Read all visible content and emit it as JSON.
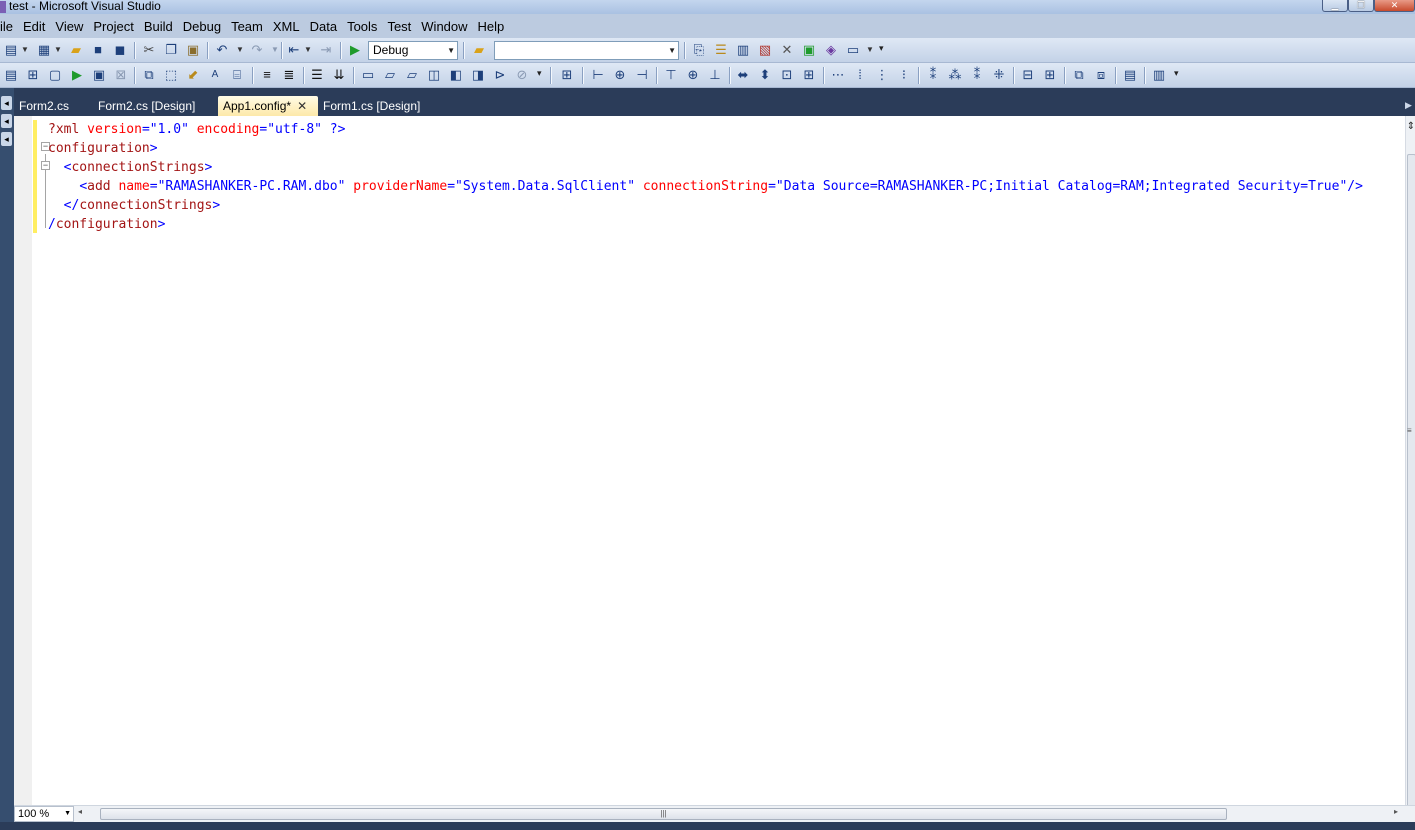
{
  "window": {
    "title": "test - Microsoft Visual Studio",
    "caption_buttons": [
      "minimize-icon",
      "maximize-icon",
      "close-icon"
    ]
  },
  "menu": {
    "items": [
      "ile",
      "Edit",
      "View",
      "Project",
      "Build",
      "Debug",
      "Team",
      "XML",
      "Data",
      "Tools",
      "Test",
      "Window",
      "Help"
    ]
  },
  "toolbar": {
    "config_value": "Debug",
    "platform_value": ""
  },
  "tabs": [
    {
      "label": "Form2.cs",
      "active": false
    },
    {
      "label": "Form2.cs [Design]",
      "active": false
    },
    {
      "label": "App1.config*",
      "active": true
    },
    {
      "label": "Form1.cs [Design]",
      "active": false
    }
  ],
  "editor": {
    "lines": [
      {
        "indent": "",
        "tokens": [
          {
            "t": "?xml",
            "k": "tag"
          },
          {
            "t": " ",
            "k": "text"
          },
          {
            "t": "version",
            "k": "attr"
          },
          {
            "t": "=",
            "k": "br"
          },
          {
            "t": "\"1.0\"",
            "k": "val"
          },
          {
            "t": " ",
            "k": "text"
          },
          {
            "t": "encoding",
            "k": "attr"
          },
          {
            "t": "=",
            "k": "br"
          },
          {
            "t": "\"utf-8\"",
            "k": "val"
          },
          {
            "t": " ?>",
            "k": "br"
          }
        ]
      },
      {
        "indent": "",
        "tokens": [
          {
            "t": "configuration",
            "k": "tag"
          },
          {
            "t": ">",
            "k": "br"
          }
        ]
      },
      {
        "indent": "  ",
        "tokens": [
          {
            "t": "<",
            "k": "br"
          },
          {
            "t": "connectionStrings",
            "k": "tag"
          },
          {
            "t": ">",
            "k": "br"
          }
        ]
      },
      {
        "indent": "    ",
        "tokens": [
          {
            "t": "<",
            "k": "br"
          },
          {
            "t": "add",
            "k": "tag"
          },
          {
            "t": " ",
            "k": "text"
          },
          {
            "t": "name",
            "k": "attr"
          },
          {
            "t": "=",
            "k": "br"
          },
          {
            "t": "\"RAMASHANKER-PC.RAM.dbo\"",
            "k": "val"
          },
          {
            "t": " ",
            "k": "text"
          },
          {
            "t": "providerName",
            "k": "attr"
          },
          {
            "t": "=",
            "k": "br"
          },
          {
            "t": "\"System.Data.SqlClient\"",
            "k": "val"
          },
          {
            "t": " ",
            "k": "text"
          },
          {
            "t": "connectionString",
            "k": "attr"
          },
          {
            "t": "=",
            "k": "br"
          },
          {
            "t": "\"Data Source=RAMASHANKER-PC;Initial Catalog=RAM;Integrated Security=True\"",
            "k": "val"
          },
          {
            "t": "/>",
            "k": "br"
          }
        ]
      },
      {
        "indent": "  ",
        "tokens": [
          {
            "t": "</",
            "k": "br"
          },
          {
            "t": "connectionStrings",
            "k": "tag"
          },
          {
            "t": ">",
            "k": "br"
          }
        ]
      },
      {
        "indent": "",
        "tokens": [
          {
            "t": "/",
            "k": "br"
          },
          {
            "t": "configuration",
            "k": "tag"
          },
          {
            "t": ">",
            "k": "br"
          }
        ]
      }
    ]
  },
  "statusbar": {
    "zoom": "100 %"
  },
  "colors": {
    "tag": "#a31515",
    "attr": "#ff0000",
    "value": "#0000ff",
    "active_tab": "#fde9a9"
  }
}
